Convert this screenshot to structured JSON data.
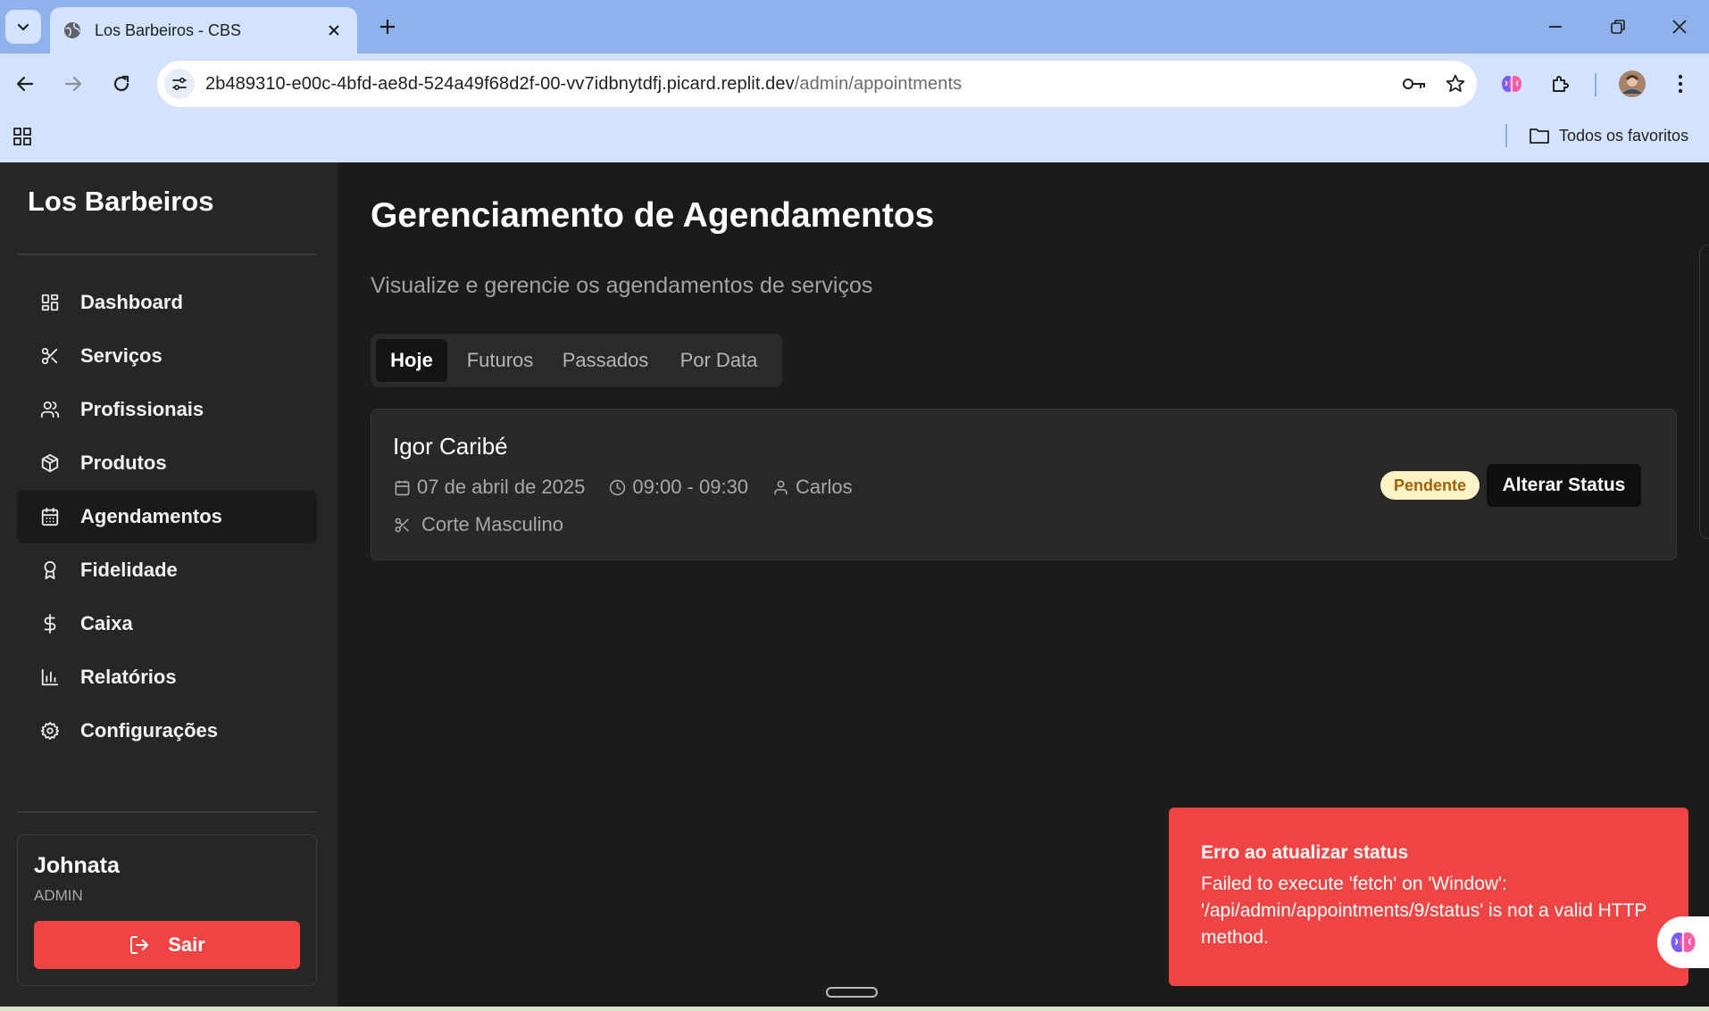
{
  "browser": {
    "tab_title": "Los Barbeiros - CBS",
    "url_host": "2b489310-e00c-4bfd-ae8d-524a49f68d2f-00-vv7idbnytdfj.picard.replit.dev",
    "url_path": "/admin/appointments",
    "bookmarks_folder": "Todos os favoritos"
  },
  "sidebar": {
    "brand": "Los Barbeiros",
    "items": [
      {
        "label": "Dashboard",
        "icon": "grid-icon"
      },
      {
        "label": "Serviços",
        "icon": "scissors-icon"
      },
      {
        "label": "Profissionais",
        "icon": "users-icon"
      },
      {
        "label": "Produtos",
        "icon": "package-icon"
      },
      {
        "label": "Agendamentos",
        "icon": "calendar-icon",
        "active": true
      },
      {
        "label": "Fidelidade",
        "icon": "award-icon"
      },
      {
        "label": "Caixa",
        "icon": "dollar-icon"
      },
      {
        "label": "Relatórios",
        "icon": "bar-chart-icon"
      },
      {
        "label": "Configurações",
        "icon": "gear-icon"
      }
    ],
    "user": {
      "name": "Johnata",
      "role": "ADMIN",
      "logout_label": "Sair"
    }
  },
  "main": {
    "title": "Gerenciamento de Agendamentos",
    "subtitle": "Visualize e gerencie os agendamentos de serviços",
    "tabs": [
      "Hoje",
      "Futuros",
      "Passados",
      "Por Data"
    ],
    "active_tab": "Hoje",
    "appointment": {
      "client": "Igor Caribé",
      "date": "07 de abril de 2025",
      "time": "09:00 - 09:30",
      "professional": "Carlos",
      "service": "Corte Masculino",
      "status": "Pendente",
      "action_label": "Alterar Status"
    }
  },
  "toast": {
    "title": "Erro ao atualizar status",
    "message": "Failed to execute 'fetch' on 'Window': '/api/admin/appointments/9/status' is not a valid HTTP method."
  },
  "colors": {
    "accent_red": "#ef4444",
    "badge_bg": "#fef3c7",
    "badge_text": "#a16207",
    "chrome_tabstrip": "#8fb2ec",
    "chrome_toolbar": "#d3e3fd"
  }
}
